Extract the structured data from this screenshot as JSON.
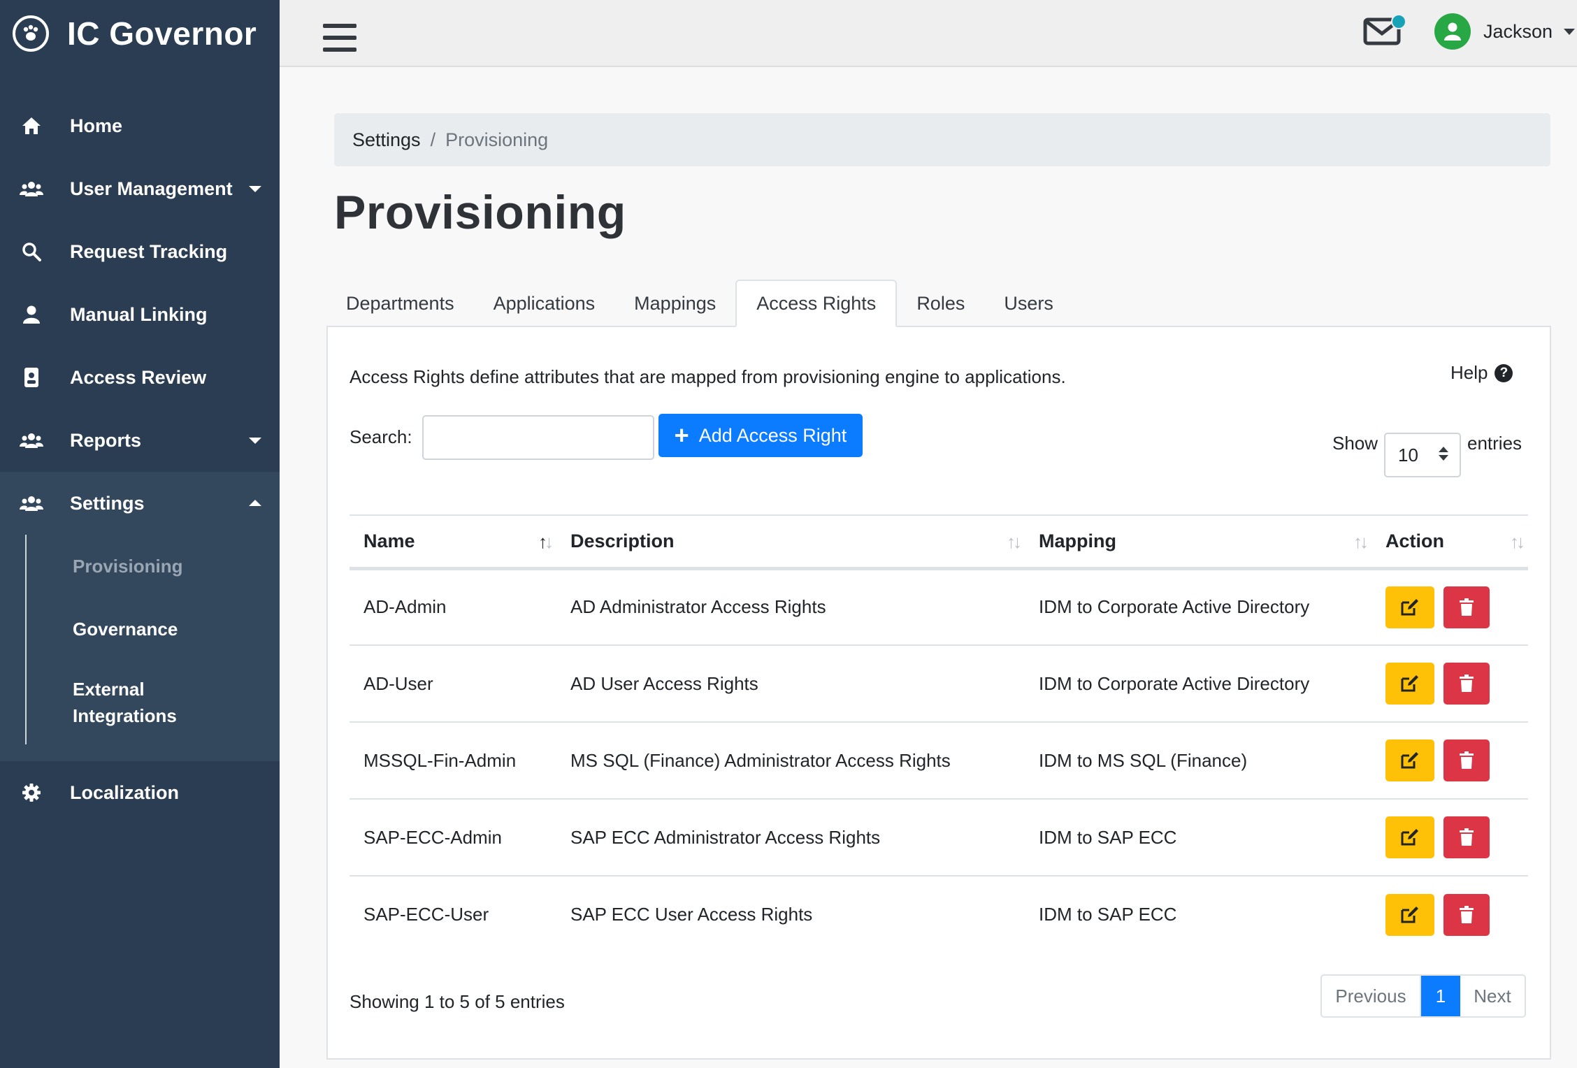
{
  "app": {
    "title": "IC Governor"
  },
  "sidebar": {
    "items": [
      {
        "label": "Home",
        "icon": "home-icon"
      },
      {
        "label": "User Management",
        "icon": "users-icon"
      },
      {
        "label": "Request Tracking",
        "icon": "search-icon"
      },
      {
        "label": "Manual Linking",
        "icon": "user-icon"
      },
      {
        "label": "Access Review",
        "icon": "id-badge-icon"
      },
      {
        "label": "Reports",
        "icon": "users-icon"
      },
      {
        "label": "Settings",
        "icon": "users-icon"
      },
      {
        "label": "Localization",
        "icon": "gear-icon"
      }
    ],
    "settings_sub": [
      "Provisioning",
      "Governance",
      "External Integrations"
    ]
  },
  "topbar": {
    "user_name": "Jackson"
  },
  "breadcrumb": {
    "parent": "Settings",
    "separator": "/",
    "current": "Provisioning"
  },
  "page": {
    "title": "Provisioning"
  },
  "tabs": [
    "Departments",
    "Applications",
    "Mappings",
    "Access Rights",
    "Roles",
    "Users"
  ],
  "panel": {
    "description": "Access Rights define attributes that are mapped from provisioning engine to applications.",
    "help_label": "Help",
    "search_label": "Search:",
    "search_value": "",
    "add_button": "Add Access Right",
    "show_label": "Show",
    "page_length": "10",
    "entries_label": "entries"
  },
  "table": {
    "headers": [
      "Name",
      "Description",
      "Mapping",
      "Action"
    ],
    "rows": [
      {
        "name": "AD-Admin",
        "description": "AD Administrator Access Rights",
        "mapping": "IDM to Corporate Active Directory"
      },
      {
        "name": "AD-User",
        "description": "AD User Access Rights",
        "mapping": "IDM to Corporate Active Directory"
      },
      {
        "name": "MSSQL-Fin-Admin",
        "description": "MS SQL (Finance) Administrator Access Rights",
        "mapping": "IDM to MS SQL (Finance)"
      },
      {
        "name": "SAP-ECC-Admin",
        "description": "SAP ECC Administrator Access Rights",
        "mapping": "IDM to SAP ECC"
      },
      {
        "name": "SAP-ECC-User",
        "description": "SAP ECC User Access Rights",
        "mapping": "IDM to SAP ECC"
      }
    ]
  },
  "footer": {
    "info": "Showing 1 to 5 of 5 entries",
    "previous": "Previous",
    "current_page": "1",
    "next": "Next"
  },
  "colors": {
    "sidebar": "#2b3d52",
    "primary": "#0b7cff",
    "edit": "#ffc107",
    "delete": "#dc3545",
    "online": "#28a745",
    "notify": "#17a2b8"
  }
}
